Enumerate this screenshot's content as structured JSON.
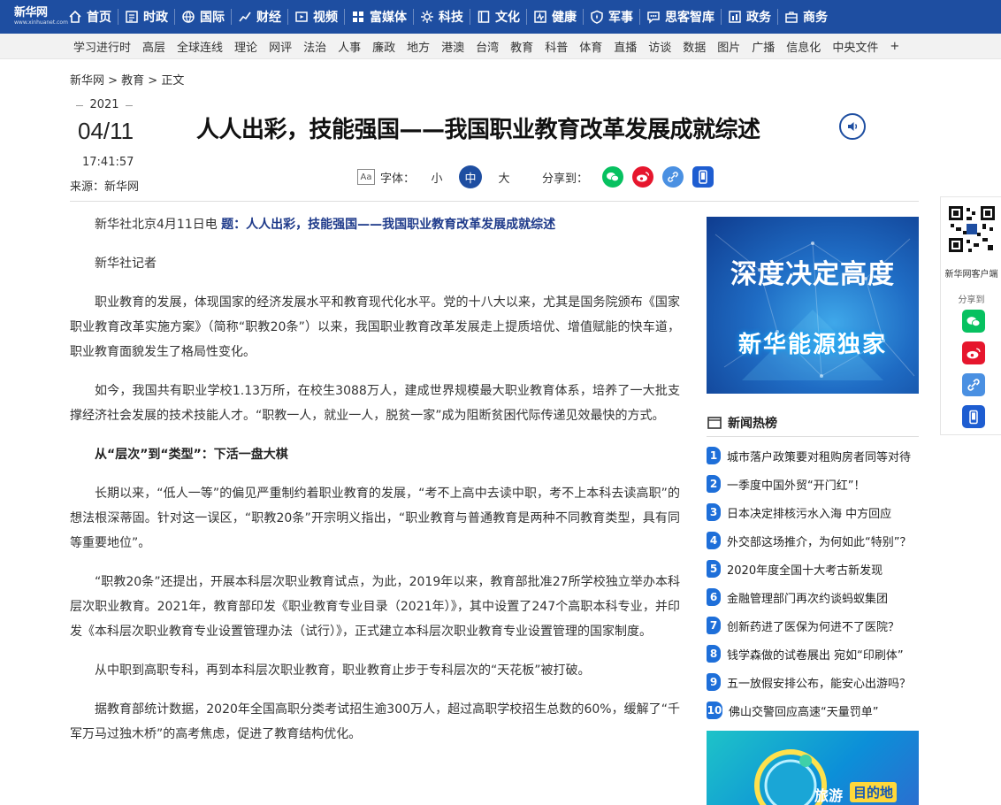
{
  "logo": {
    "main": "新华网",
    "sub": "www.xinhuanet.com"
  },
  "nav": [
    {
      "label": "首页",
      "icon": "home-icon"
    },
    {
      "label": "时政",
      "icon": "news-icon"
    },
    {
      "label": "国际",
      "icon": "globe-icon"
    },
    {
      "label": "财经",
      "icon": "finance-icon"
    },
    {
      "label": "视频",
      "icon": "video-icon"
    },
    {
      "label": "富媒体",
      "icon": "media-icon"
    },
    {
      "label": "科技",
      "icon": "tech-icon"
    },
    {
      "label": "文化",
      "icon": "culture-icon"
    },
    {
      "label": "健康",
      "icon": "health-icon"
    },
    {
      "label": "军事",
      "icon": "military-icon"
    },
    {
      "label": "思客智库",
      "icon": "thinktank-icon"
    },
    {
      "label": "政务",
      "icon": "government-icon"
    },
    {
      "label": "商务",
      "icon": "business-icon"
    }
  ],
  "subnav": [
    "学习进行时",
    "高层",
    "全球连线",
    "理论",
    "网评",
    "法治",
    "人事",
    "廉政",
    "地方",
    "港澳",
    "台湾",
    "教育",
    "科普",
    "体育",
    "直播",
    "访谈",
    "数据",
    "图片",
    "广播",
    "信息化",
    "中央文件",
    "+"
  ],
  "breadcrumb": "新华网 > 教育 > 正文",
  "article": {
    "year": "2021",
    "date": "04/11",
    "time": "17:41:57",
    "source": "来源：新华网",
    "title": "人人出彩，技能强国——我国职业教育改革发展成就综述",
    "font_label": "字体：",
    "font_sizes": [
      "小",
      "中",
      "大"
    ],
    "share_label": "分享到：",
    "lead_prefix": "新华社北京4月11日电 ",
    "lead_title": "题：人人出彩，技能强国——我国职业教育改革发展成就综述",
    "paragraphs": [
      "新华社记者",
      "职业教育的发展，体现国家的经济发展水平和教育现代化水平。党的十八大以来，尤其是国务院颁布《国家职业教育改革实施方案》（简称“职教20条”）以来，我国职业教育改革发展走上提质培优、增值赋能的快车道，职业教育面貌发生了格局性变化。",
      "如今，我国共有职业学校1.13万所，在校生3088万人，建成世界规模最大职业教育体系，培养了一大批支撑经济社会发展的技术技能人才。“职教一人，就业一人，脱贫一家”成为阻断贫困代际传递见效最快的方式。"
    ],
    "subheading": "从“层次”到“类型”：下活一盘大棋",
    "paragraphs2": [
      "长期以来，“低人一等”的偏见严重制约着职业教育的发展，“考不上高中去读中职，考不上本科去读高职”的想法根深蒂固。针对这一误区，“职教20条”开宗明义指出，“职业教育与普通教育是两种不同教育类型，具有同等重要地位”。",
      "“职教20条”还提出，开展本科层次职业教育试点，为此，2019年以来，教育部批准27所学校独立举办本科层次职业教育。2021年，教育部印发《职业教育专业目录（2021年）》，其中设置了247个高职本科专业，并印发《本科层次职业教育专业设置管理办法（试行）》，正式建立本科层次职业教育专业设置管理的国家制度。",
      "从中职到高职专科，再到本科层次职业教育，职业教育止步于专科层次的“天花板”被打破。",
      "据教育部统计数据，2020年全国高职分类考试招生逾300万人，超过高职学校招生总数的60%，缓解了“千军万马过独木桥”的高考焦虑，促进了教育结构优化。"
    ]
  },
  "banner": {
    "line1": "深度决定高度",
    "line2": "新华能源独家"
  },
  "hot": {
    "title": "新闻热榜",
    "items": [
      {
        "rank": "1",
        "text": "城市落户政策要对租购房者同等对待"
      },
      {
        "rank": "2",
        "text": "一季度中国外贸“开门红”！"
      },
      {
        "rank": "3",
        "text": "日本决定排核污水入海 中方回应"
      },
      {
        "rank": "4",
        "text": "外交部这场推介，为何如此“特别”？"
      },
      {
        "rank": "5",
        "text": "2020年度全国十大考古新发现"
      },
      {
        "rank": "6",
        "text": "金融管理部门再次约谈蚂蚁集团"
      },
      {
        "rank": "7",
        "text": "创新药进了医保为何进不了医院？"
      },
      {
        "rank": "8",
        "text": "钱学森做的试卷展出 宛如“印刷体”"
      },
      {
        "rank": "9",
        "text": "五一放假安排公布，能安心出游吗？"
      },
      {
        "rank": "10",
        "text": "佛山交警回应高速“天量罚单”"
      }
    ]
  },
  "promo": {
    "tag1": "旅游",
    "tag2": "目的地"
  },
  "side": {
    "app_label": "新华网客户端",
    "share_label": "分享到"
  },
  "colors": {
    "brand": "#1e4ea1",
    "rank": "#1e6fd9",
    "wechat": "#07c160",
    "weibo": "#e6162d",
    "link": "#4a90e2",
    "mobile": "#1e5dd1"
  }
}
